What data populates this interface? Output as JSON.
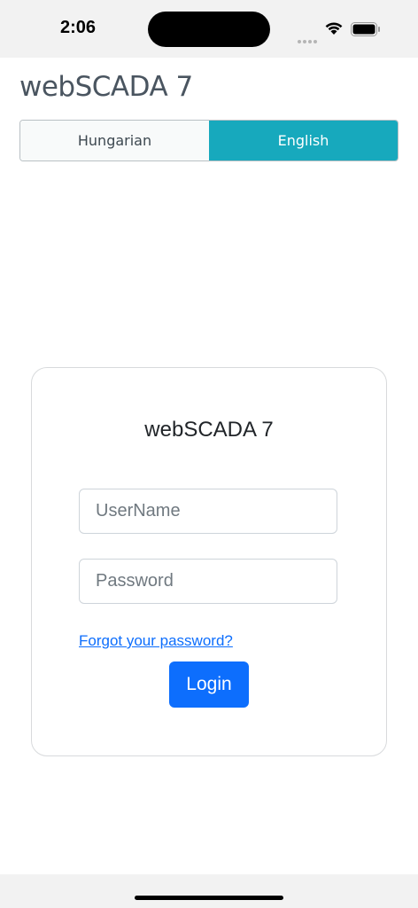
{
  "status_bar": {
    "time": "2:06",
    "icons": [
      "signal-dots-icon",
      "wifi-icon",
      "battery-icon"
    ]
  },
  "app": {
    "title": "webSCADA 7"
  },
  "language_toggle": {
    "options": [
      {
        "label": "Hungarian",
        "selected": false
      },
      {
        "label": "English",
        "selected": true
      }
    ],
    "selected_color": "#17a9bd"
  },
  "login_card": {
    "title": "webSCADA 7",
    "username": {
      "placeholder": "UserName",
      "value": ""
    },
    "password": {
      "placeholder": "Password",
      "value": ""
    },
    "forgot_link": "Forgot your password?",
    "login_button": "Login",
    "accent_color": "#0d6efd"
  }
}
